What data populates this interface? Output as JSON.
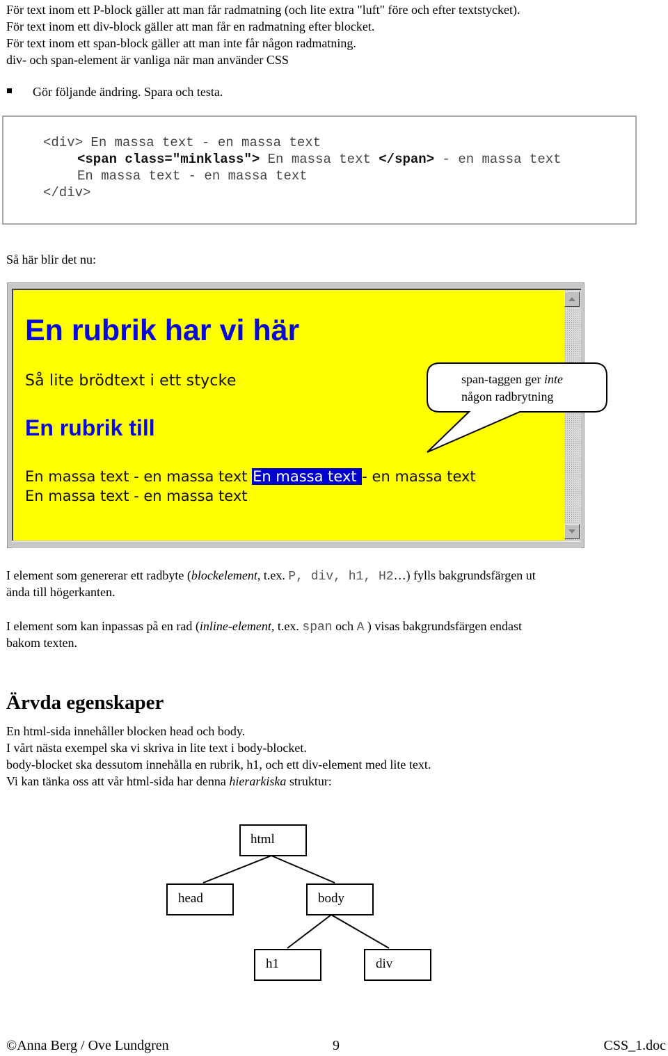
{
  "intro": {
    "lines": [
      "För text inom ett P-block gäller att man får  radmatning (och lite extra \"luft\" före och efter textstycket).",
      "För text inom ett div-block gäller att man får en radmatning efter blocket.",
      "För text inom ett span-block gäller att man inte får någon radmatning.",
      "div- och span-element är vanliga när man använder CSS"
    ],
    "bullet": "Gör följande ändring.  Spara och testa."
  },
  "code": {
    "line1": "<div> En massa text - en massa text",
    "line2_open_tag": "<span class=\"minklass\">",
    "line2_mid": " En massa text ",
    "line2_close_tag": "</span>",
    "line2_tail": " - en massa text",
    "line3": "En massa text - en massa text",
    "line4": "</div>"
  },
  "result_label": "Så här blir det nu:",
  "browser": {
    "h1": "En rubrik har vi här",
    "paragraph": "Så lite brödtext i ett stycke",
    "h2": "En rubrik till",
    "div_line1_before": "En massa text - en massa text ",
    "div_line1_span": "En massa text ",
    "div_line1_after": "- en massa text",
    "div_line2": "En massa text - en massa text",
    "colors": {
      "background": "#ffff00",
      "heading": "#0a0ad8",
      "span_background": "#0000cc",
      "span_text": "#ffffff"
    }
  },
  "callout": {
    "text_before": "span-taggen ger ",
    "text_em": "inte",
    "line2": "någon radbrytning"
  },
  "explain": {
    "p1_a": "I element som genererar ett radbyte  (",
    "p1_em": "blockelement",
    "p1_b": ", t.ex. ",
    "p1_code": "P, div, h1, H2",
    "p1_c": "…)  fylls bakgrundsfärgen ut",
    "p1_line2": "ända till högerkanten.",
    "p2_a": "I element som kan inpassas på en rad (",
    "p2_em": "inline-element,",
    "p2_b": "  t.ex. ",
    "p2_code1": "span",
    "p2_c": " och ",
    "p2_code2": "A",
    "p2_d": " ) visas bakgrundsfärgen endast",
    "p2_line2": "bakom texten."
  },
  "section": {
    "heading": "Ärvda egenskaper",
    "lines": [
      "En html-sida innehåller blocken head och body.",
      "I vårt nästa exempel ska vi skriva in lite text i body-blocket.",
      "body-blocket  ska dessutom innehålla en rubrik, h1, och ett div-element med lite text."
    ],
    "last_a": "Vi kan tänka oss att vår html-sida har denna ",
    "last_em": "hierarkiska",
    "last_b": " struktur:"
  },
  "tree": {
    "root": "html",
    "children": [
      "head",
      "body"
    ],
    "body_children": [
      "h1",
      "div"
    ]
  },
  "footer": {
    "left": "©Anna Berg / Ove Lundgren",
    "center": "9",
    "right": "CSS_1.doc"
  }
}
